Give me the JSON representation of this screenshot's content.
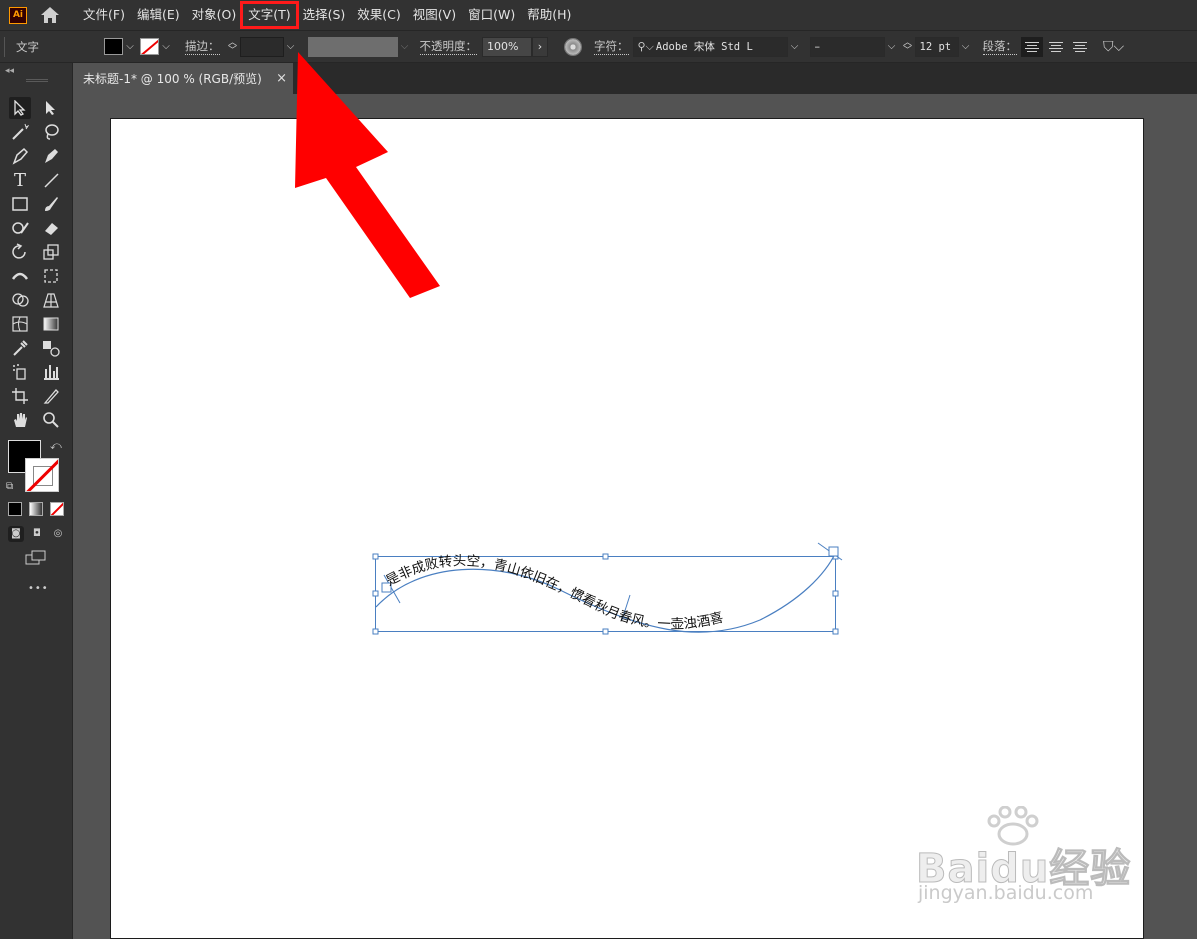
{
  "app": {
    "logo_text": "Ai"
  },
  "menu": {
    "items": [
      "文件(F)",
      "编辑(E)",
      "对象(O)",
      "文字(T)",
      "选择(S)",
      "效果(C)",
      "视图(V)",
      "窗口(W)",
      "帮助(H)"
    ],
    "highlighted_index": 3,
    "highlight_color": "#ff1a1a"
  },
  "control": {
    "mode_label": "文字",
    "stroke_label": "描边：",
    "opacity_label": "不透明度：",
    "opacity_value": "100%",
    "char_label": "字符：",
    "font_family": "Adobe 宋体 Std L",
    "font_style": "–",
    "font_size": "12 pt",
    "paragraph_label": "段落："
  },
  "document": {
    "tab_title": "未标题-1* @ 100 % (RGB/预览)",
    "close_glyph": "×"
  },
  "canvas": {
    "path_text": "是非成败转头空，青山依旧在，惯看秋月春风。一壶浊酒喜",
    "selection_color": "#4a7fc1"
  },
  "annotation": {
    "arrow_color": "#ff0000"
  },
  "watermark": {
    "brand": "Baidu经验",
    "url": "jingyan.baidu.com"
  },
  "toolbar": {
    "more_glyph": "•••"
  }
}
